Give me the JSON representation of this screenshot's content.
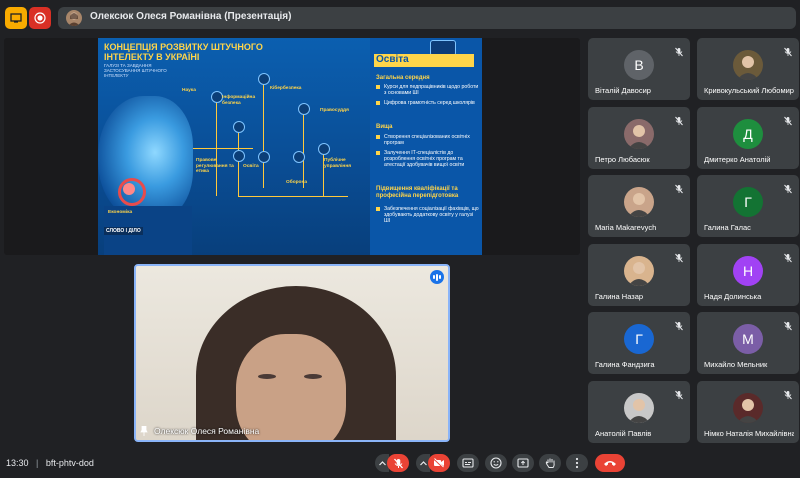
{
  "top_bar": {
    "presenter_title": "Олексюк Олеся Романівна (Презентація)"
  },
  "slide": {
    "title": "КОНЦЕПЦІЯ РОЗВИТКУ ШТУЧНОГО ІНТЕЛЕКТУ В УКРАЇНІ",
    "subtitle": "ГАЛУЗІ ТА ЗАВДАННЯ ЗАСТОСУВАННЯ ШТУЧНОГО ІНТЕЛЕКТУ",
    "sections": [
      "Наука",
      "Інформаційна безпека",
      "Кібербезпека",
      "Правосуддя",
      "Правове регулювання та етика",
      "Освіта",
      "Оборона",
      "Публічне управління",
      "Економіка"
    ],
    "logo": "СЛОВО І ДІЛО",
    "right_panel": {
      "heading": "Освіта",
      "blocks": [
        {
          "title": "Загальна середня",
          "items": [
            "Курси для педпрацівників щодо роботи з основами ШІ",
            "Цифрова грамотність серед школярів"
          ]
        },
        {
          "title": "Вища",
          "items": [
            "Створення спеціалізованих освітніх програм",
            "Залучення ІТ-спеціалістів до розроблення освітніх програм та атестації здобувачів вищої освіти"
          ]
        },
        {
          "title": "Підвищення кваліфікації та професійна перепідготовка",
          "items": [
            "Забезпечення соціалізації фахівців, що здобувають додаткову освіту у галузі ШІ"
          ]
        }
      ]
    }
  },
  "camera": {
    "name": "Олексюк Олеся Романівна"
  },
  "participants": [
    {
      "name": "Віталій Давосир",
      "initial": "В",
      "color": "#5f6368",
      "photo": false
    },
    {
      "name": "Кривокульський Любомир",
      "initial": "",
      "color": "#6b5a3a",
      "photo": true
    },
    {
      "name": "Петро Любасюк",
      "initial": "",
      "color": "#8a6a6a",
      "photo": true
    },
    {
      "name": "Дмитерко Анатолій",
      "initial": "Д",
      "color": "#1e8e3e",
      "photo": false
    },
    {
      "name": "Maria Makarevych",
      "initial": "",
      "color": "#c9a48a",
      "photo": true
    },
    {
      "name": "Галина Галас",
      "initial": "Г",
      "color": "#137333",
      "photo": false
    },
    {
      "name": "Галина Назар",
      "initial": "",
      "color": "#d9b48e",
      "photo": true
    },
    {
      "name": "Надя Долинська",
      "initial": "Н",
      "color": "#a142f4",
      "photo": false
    },
    {
      "name": "Галина Фандзига",
      "initial": "Г",
      "color": "#1967d2",
      "photo": false
    },
    {
      "name": "Михайло Мельник",
      "initial": "М",
      "color": "#7b5ea7",
      "photo": false
    },
    {
      "name": "Анатолій Павлів",
      "initial": "",
      "color": "#c8c8c8",
      "photo": true
    },
    {
      "name": "Німко Наталія Михайлівна",
      "initial": "",
      "color": "#5a2a2a",
      "photo": true
    }
  ],
  "bottom_bar": {
    "time": "13:30",
    "separator": "|",
    "meeting_code": "bft-phtv-dod"
  }
}
